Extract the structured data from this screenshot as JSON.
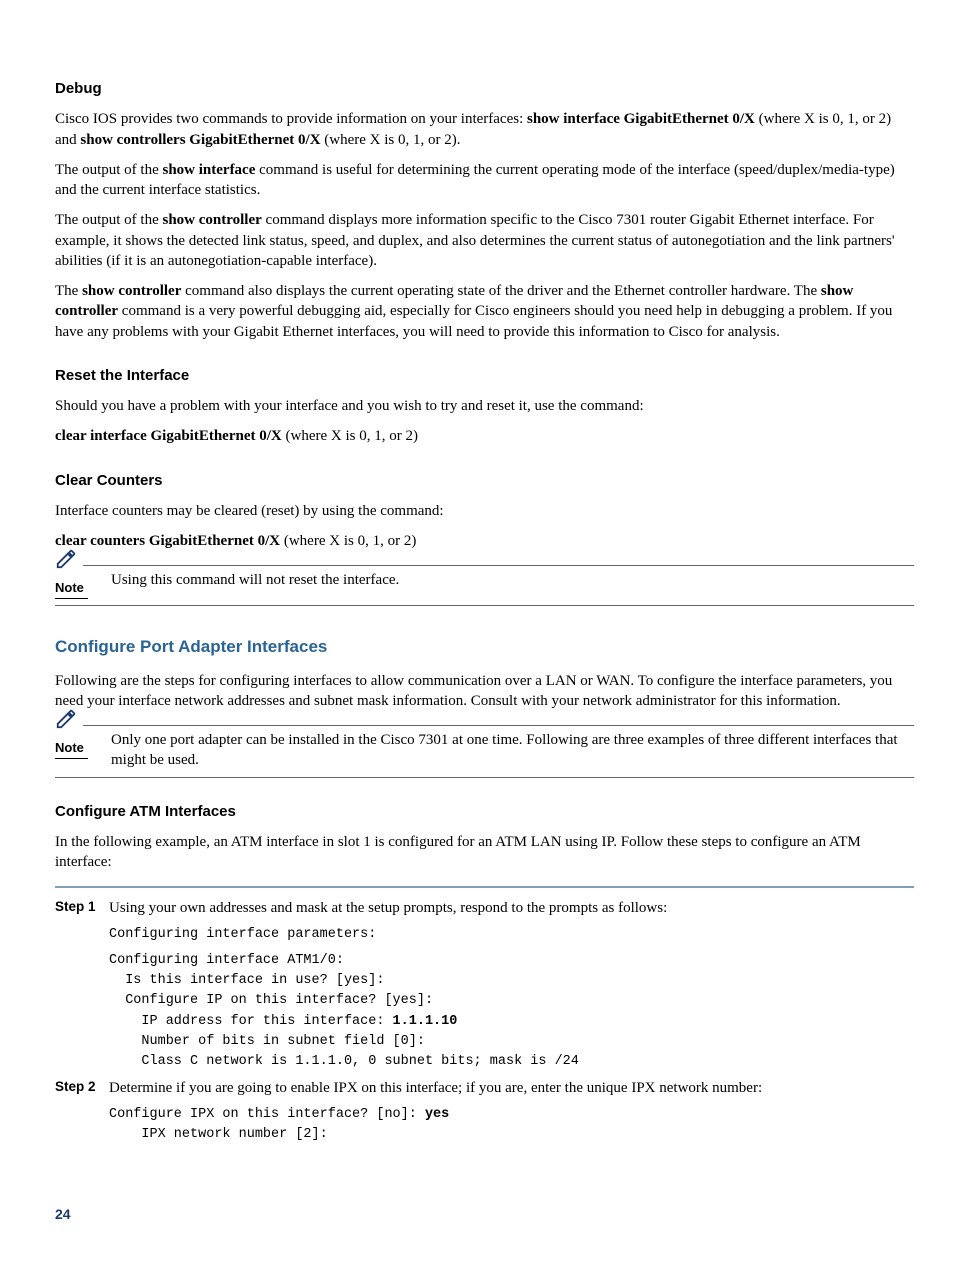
{
  "debug": {
    "heading": "Debug",
    "p1_a": "Cisco IOS provides two commands to provide information on your interfaces: ",
    "p1_b": "show interface GigabitEthernet 0/X",
    "p1_c": " (where X is 0, 1, or 2) and ",
    "p1_d": "show controllers GigabitEthernet 0/X",
    "p1_e": " (where X is 0, 1, or 2).",
    "p2_a": "The output of the ",
    "p2_b": "show interface",
    "p2_c": " command is useful for determining the current operating mode of the interface (speed/duplex/media-type) and the current interface statistics.",
    "p3_a": "The output of the ",
    "p3_b": "show controller",
    "p3_c": " command displays more information specific to the Cisco 7301 router Gigabit Ethernet interface. For example, it shows the detected link status, speed, and duplex, and also determines the current status of autonegotiation and the link partners' abilities (if it is an autonegotiation-capable interface).",
    "p4_a": "The ",
    "p4_b": "show controller",
    "p4_c": " command also displays the current operating state of the driver and the Ethernet controller hardware. The ",
    "p4_d": "show controller",
    "p4_e": " command is a very powerful debugging aid, especially for Cisco engineers should you need help in debugging a problem. If you have any problems with your Gigabit Ethernet interfaces, you will need to provide this information to Cisco for analysis."
  },
  "reset": {
    "heading": "Reset the Interface",
    "p1": "Should you have a problem with your interface and you wish to try and reset it, use the command:",
    "cmd_a": "clear interface GigabitEthernet 0/X",
    "cmd_b": "   (where X is 0, 1, or 2)"
  },
  "counters": {
    "heading": "Clear Counters",
    "p1": "Interface counters may be cleared (reset) by using the command:",
    "cmd_a": "clear counters GigabitEthernet 0/X",
    "cmd_b": "   (where X is 0, 1, or 2)"
  },
  "note1": {
    "label": "Note",
    "text": "Using this command will not reset the interface."
  },
  "portadapter": {
    "heading": "Configure Port Adapter Interfaces",
    "p1": "Following are the steps for configuring interfaces to allow communication over a LAN or WAN. To configure the interface parameters, you need your interface network addresses and subnet mask information. Consult with your network administrator for this information."
  },
  "note2": {
    "label": "Note",
    "text": "Only one port adapter can be installed in the Cisco 7301 at one time. Following are three examples of three different interfaces that might be used."
  },
  "atm": {
    "heading": "Configure ATM Interfaces",
    "p1": "In the following example, an ATM interface in slot 1 is configured for an ATM LAN using IP. Follow these steps to configure an ATM interface:"
  },
  "step1": {
    "label": "Step 1",
    "text": "Using your own addresses and mask at the setup prompts, respond to the prompts as follows:",
    "console_a": "Configuring interface parameters:",
    "console_b": "Configuring interface ATM1/0:\n  Is this interface in use? [yes]:\n  Configure IP on this interface? [yes]:\n    IP address for this interface: ",
    "console_b_bold": "1.1.1.10",
    "console_c": "\n    Number of bits in subnet field [0]:\n    Class C network is 1.1.1.0, 0 subnet bits; mask is /24"
  },
  "step2": {
    "label": "Step 2",
    "text": "Determine if you are going to enable IPX on this interface; if you are, enter the unique IPX network number:",
    "console_a": "Configure IPX on this interface? [no]: ",
    "console_a_bold": "yes",
    "console_b": "\n    IPX network number [2]:"
  },
  "pagenum": "24"
}
